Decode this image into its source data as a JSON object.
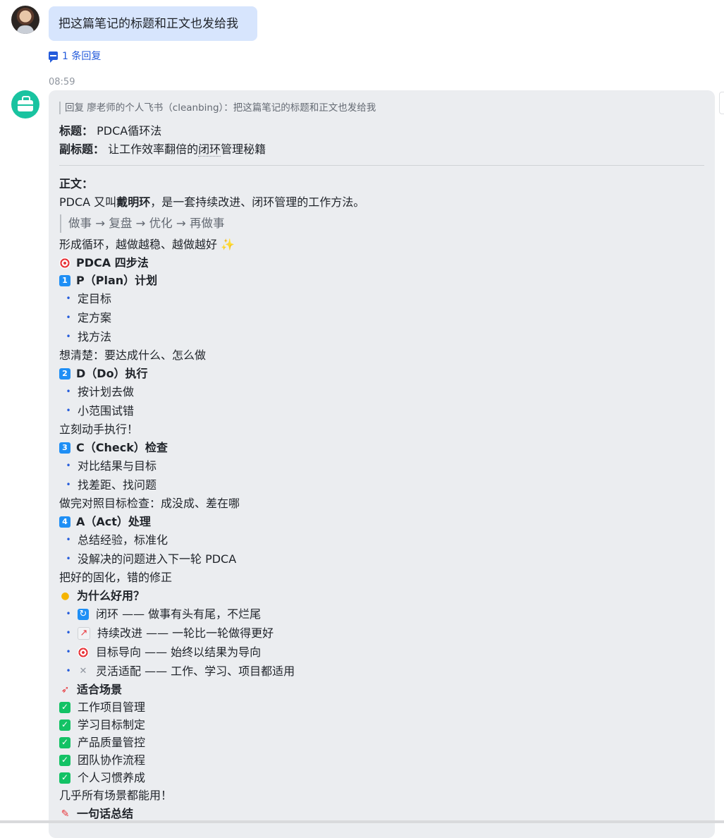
{
  "user_message": {
    "text": "把这篇笔记的标题和正文也发给我",
    "reply_count": "1 条回复"
  },
  "timestamp": "08:59",
  "bot_message": {
    "reply_quote": "回复 廖老师的个人飞书（cleanbing）：把这篇笔记的标题和正文也发给我",
    "title_label": "标题：",
    "title_value": "PDCA循环法",
    "subtitle_label": "副标题：",
    "subtitle_value_pre": "让工作效率翻倍的",
    "subtitle_value_dotted": "闭环",
    "subtitle_value_post": "管理秘籍",
    "body_label": "正文：",
    "intro_pre": "PDCA 又叫",
    "intro_bold": "戴明环",
    "intro_post": "，是一套持续改进、闭环管理的工作方法。",
    "flow_quote": "做事 → 复盘 → 优化 → 再做事",
    "loop_line": "形成循环，越做越稳、越做越好 ✨",
    "four_steps_heading": "PDCA 四步法",
    "steps": [
      {
        "badge": "1",
        "title": "P（Plan）计划",
        "bullets": [
          "定目标",
          "定方案",
          "找方法"
        ],
        "note": "想清楚：要达成什么、怎么做"
      },
      {
        "badge": "2",
        "title": "D（Do）执行",
        "bullets": [
          "按计划去做",
          "小范围试错"
        ],
        "note": "立刻动手执行！"
      },
      {
        "badge": "3",
        "title": "C（Check）检查",
        "bullets": [
          "对比结果与目标",
          "找差距、找问题"
        ],
        "note": "做完对照目标检查：成没成、差在哪"
      },
      {
        "badge": "4",
        "title": "A（Act）处理",
        "bullets": [
          "总结经验，标准化",
          "没解决的问题进入下一轮 PDCA"
        ],
        "note": "把好的固化，错的修正"
      }
    ],
    "why_heading": "为什么好用？",
    "why_items": [
      {
        "icon": "refresh-icon",
        "text": "闭环 —— 做事有头有尾，不烂尾"
      },
      {
        "icon": "chart-up-icon",
        "text": "持续改进 —— 一轮比一轮做得更好"
      },
      {
        "icon": "target-icon",
        "text": "目标导向 —— 始终以结果为导向"
      },
      {
        "icon": "wrench-icon",
        "text": "灵活适配 —— 工作、学习、项目都适用"
      }
    ],
    "scenes_heading": "适合场景",
    "scenes": [
      "工作项目管理",
      "学习目标制定",
      "产品质量管控",
      "团队协作流程",
      "个人习惯养成"
    ],
    "scenes_note": "几乎所有场景都能用！",
    "summary_heading": "一句话总结"
  },
  "colors": {
    "user_bubble": "#d7e5fd",
    "bot_bubble": "#ebedf0",
    "link_blue": "#245bdb",
    "bot_avatar": "#19c3a0",
    "check_green": "#13c265",
    "badge_blue": "#1f8ff5"
  }
}
